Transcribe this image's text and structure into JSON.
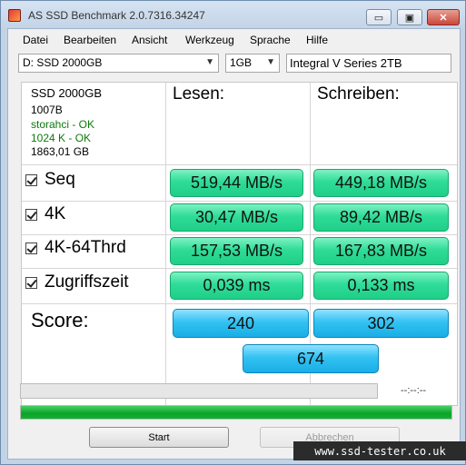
{
  "window": {
    "title": "AS SSD Benchmark 2.0.7316.34247",
    "min_label": "▭",
    "max_label": "▣",
    "close_label": "✕"
  },
  "menu": [
    "Datei",
    "Bearbeiten",
    "Ansicht",
    "Werkzeug",
    "Sprache",
    "Hilfe"
  ],
  "toolbar": {
    "drive_select": "D: SSD 2000GB",
    "size_select": "1GB",
    "drive_name": "Integral V Series 2TB"
  },
  "drive_info": {
    "model": "SSD 2000GB",
    "firmware": "1007B",
    "driver": "storahci - OK",
    "alignment": "1024 K - OK",
    "capacity": "1863,01 GB"
  },
  "columns": {
    "read": "Lesen:",
    "write": "Schreiben:"
  },
  "rows": [
    {
      "label": "Seq",
      "read": "519,44 MB/s",
      "write": "449,18 MB/s"
    },
    {
      "label": "4K",
      "read": "30,47 MB/s",
      "write": "89,42 MB/s"
    },
    {
      "label": "4K-64Thrd",
      "read": "157,53 MB/s",
      "write": "167,83 MB/s"
    },
    {
      "label": "Zugriffszeit",
      "read": "0,039 ms",
      "write": "0,133 ms"
    }
  ],
  "score": {
    "label": "Score:",
    "read": "240",
    "write": "302",
    "total": "674"
  },
  "progress": {
    "time": "--:--:--",
    "fill_fraction": 1.0
  },
  "buttons": {
    "start": "Start",
    "abort": "Abbrechen"
  },
  "watermark": "www.ssd-tester.co.uk",
  "colors": {
    "result": "#2fdc97",
    "score": "#33c2f2",
    "progress": "#0aa329"
  }
}
